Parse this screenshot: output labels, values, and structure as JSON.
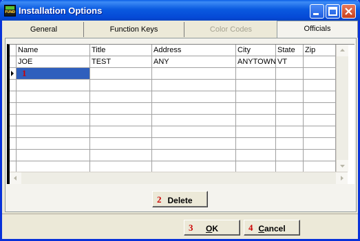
{
  "window": {
    "title": "Installation Options",
    "app_icon_text": "FUND"
  },
  "tabs": [
    {
      "label": "General",
      "state": "normal"
    },
    {
      "label": "Function Keys",
      "state": "normal"
    },
    {
      "label": "Color Codes",
      "state": "disabled"
    },
    {
      "label": "Officials",
      "state": "active"
    }
  ],
  "grid": {
    "columns": [
      "Name",
      "Title",
      "Address",
      "City",
      "State",
      "Zip"
    ],
    "rows": [
      [
        "JOE",
        "TEST",
        "ANY",
        "ANYTOWN",
        "VT",
        ""
      ]
    ],
    "new_row_marker": "1",
    "selection_color": "#2f5fbd"
  },
  "buttons": {
    "delete": {
      "number": "2",
      "label": "Delete"
    },
    "ok": {
      "number": "3",
      "label_first": "O",
      "label_rest": "K"
    },
    "cancel": {
      "number": "4",
      "label_first": "C",
      "label_rest": "ancel"
    }
  },
  "colors": {
    "title_bar": "#0a5ae0",
    "marker_red": "#cc0000"
  }
}
